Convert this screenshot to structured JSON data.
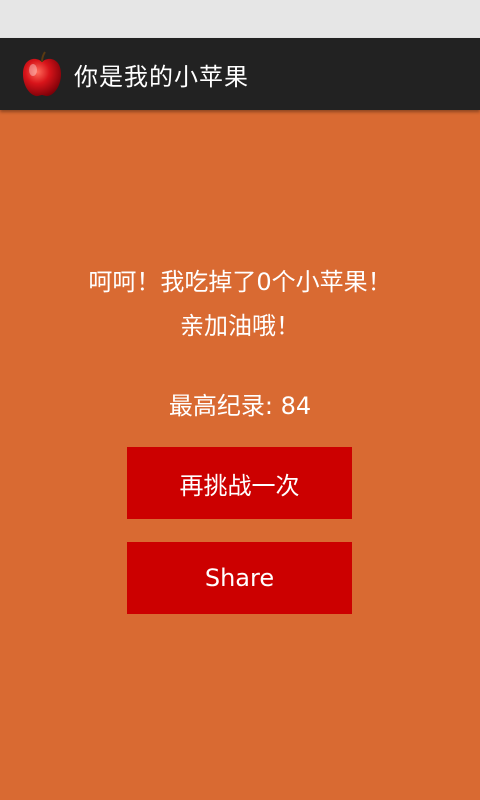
{
  "header": {
    "app_icon": "red-apple-icon",
    "title": "你是我的小苹果"
  },
  "result": {
    "line1": "呵呵！我吃掉了0个小苹果！",
    "line2": "亲加油哦！"
  },
  "record": {
    "text": "最高纪录: 84"
  },
  "buttons": {
    "retry_label": "再挑战一次",
    "share_label": "Share"
  },
  "colors": {
    "background": "#d96a32",
    "action_bar": "#222222",
    "button": "#cc0000",
    "status_bar": "#e6e6e6"
  }
}
